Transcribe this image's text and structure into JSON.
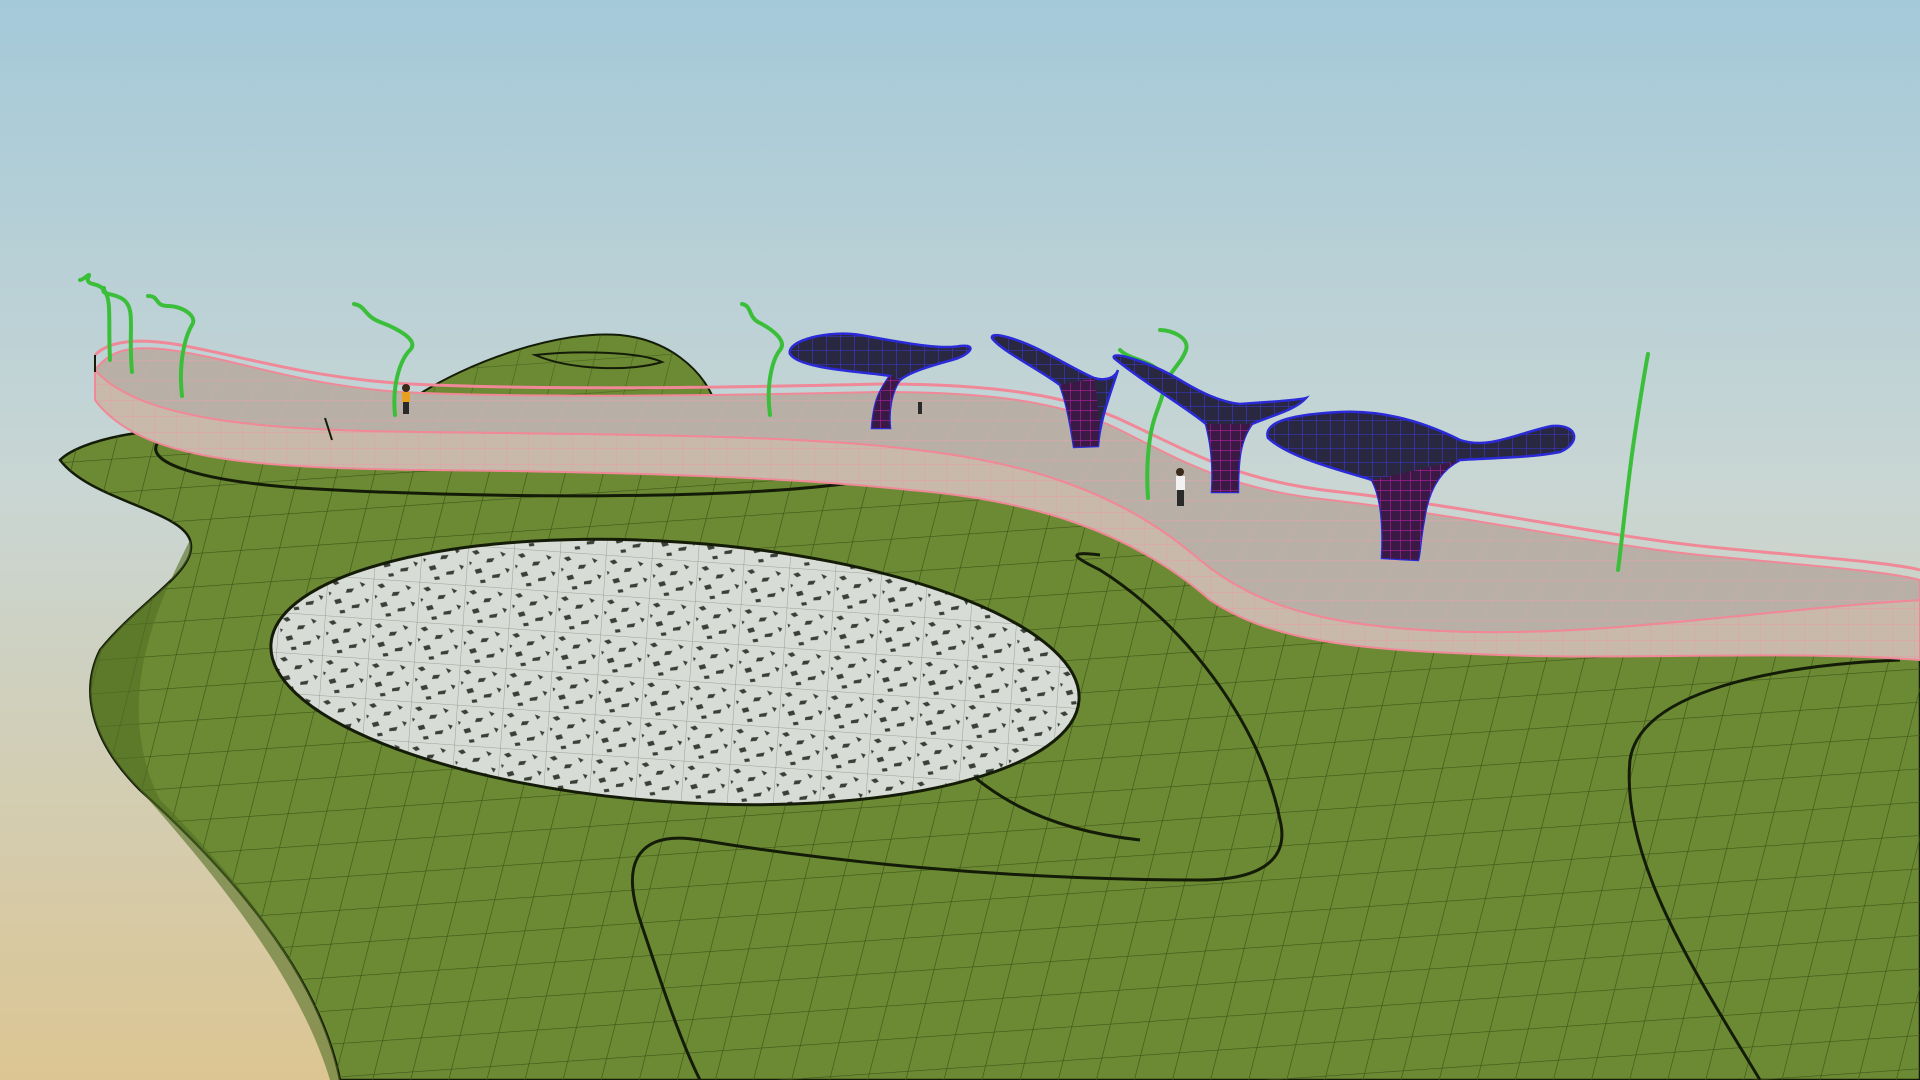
{
  "viewport": {
    "sky_top": "#a4c9d9",
    "sky_mid": "#c9d6d4",
    "sky_bottom": "#dcc592"
  },
  "palette": {
    "terrain_fill": "#6b8a33",
    "terrain_fill_dark": "#546f24",
    "terrain_grid": "#3e5418",
    "contour_line": "#141c08",
    "plaza_fill": "#d8dcd6",
    "plaza_speckle": "#3a3f37",
    "bridge_deck": "#b8b0a6",
    "bridge_side": "#c9b9aa",
    "bridge_edge": "#f08898",
    "lamp_post": "#3bbf3b",
    "canopy_wire": "#2a2ad8",
    "canopy_inner": "#9a1a8a",
    "canopy_shade": "#2a2840"
  },
  "objects": {
    "terrain": "terrain-surface",
    "plaza": "plaza-disc",
    "bridge": "bridge-walkway",
    "canopies": [
      "canopy-1",
      "canopy-2",
      "canopy-3",
      "canopy-4"
    ],
    "lamps": [
      "lamp-1",
      "lamp-2",
      "lamp-3",
      "lamp-4",
      "lamp-5",
      "lamp-6",
      "lamp-7",
      "lamp-8"
    ],
    "people": [
      "person-1",
      "person-2",
      "person-3"
    ]
  }
}
